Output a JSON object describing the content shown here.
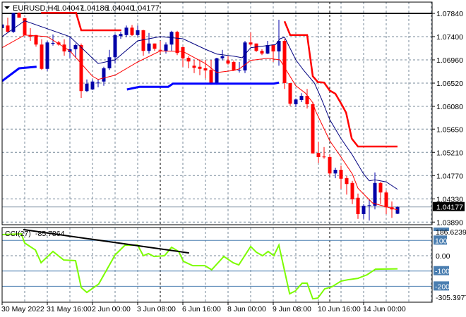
{
  "header": {
    "symbol": "EURUSD,H4",
    "open": "1.04047",
    "high": "1.04186",
    "low": "1.04040",
    "close": "1.04177"
  },
  "colors": {
    "bull": "#0000a8",
    "bear": "#ff0000",
    "ma_fast": "#000080",
    "ma_slow": "#ff0000",
    "stop_upper": "#ff0000",
    "stop_lower": "#0000ff",
    "cci": "#7cfc00",
    "level": "#4a7eb0",
    "grid": "#778899"
  },
  "chart_data": [
    {
      "type": "candlestick",
      "title": "EURUSD,H4",
      "ylim": [
        1.0389,
        1.0784
      ],
      "y_ticks": [
        "1.07840",
        "1.07400",
        "1.06960",
        "1.06520",
        "1.06080",
        "1.05650",
        "1.05210",
        "1.04770",
        "1.04330",
        "1.03890"
      ],
      "y_tick_values": [
        1.0784,
        1.074,
        1.0696,
        1.0652,
        1.0608,
        1.0565,
        1.0521,
        1.0477,
        1.0433,
        1.0389
      ],
      "current_price_label": "1.04177",
      "current_price": 1.04177,
      "horizontal_line": 1.0784,
      "x_tick_labels": [
        "30 May 2022",
        "31 May 16:00",
        "2 Jun 00:00",
        "3 Jun 08:00",
        "6 Jun 16:00",
        "8 Jun 00:00",
        "9 Jun 08:00",
        "10 Jun 16:00",
        "14 Jun 00:00"
      ],
      "x_tick_candle_index": [
        0,
        8,
        16,
        24,
        32,
        40,
        48,
        56,
        64
      ],
      "period_separators": [
        28,
        58
      ],
      "ohlc": [
        [
          1.0756,
          1.0767,
          1.0743,
          1.0763
        ],
        [
          1.0761,
          1.0776,
          1.0749,
          1.0749
        ],
        [
          1.0749,
          1.0785,
          1.0747,
          1.0785
        ],
        [
          1.0785,
          1.0786,
          1.0776,
          1.0776
        ],
        [
          1.0775,
          1.0775,
          1.0743,
          1.0743
        ],
        [
          1.0743,
          1.0756,
          1.0732,
          1.074
        ],
        [
          1.0743,
          1.0743,
          1.0721,
          1.0725
        ],
        [
          1.0725,
          1.0735,
          1.0677,
          1.0679
        ],
        [
          1.0679,
          1.0732,
          1.0675,
          1.0729
        ],
        [
          1.0727,
          1.0744,
          1.0723,
          1.0728
        ],
        [
          1.0729,
          1.0732,
          1.0723,
          1.0725
        ],
        [
          1.0725,
          1.0735,
          1.0704,
          1.0712
        ],
        [
          1.0711,
          1.074,
          1.07,
          1.0716
        ],
        [
          1.0716,
          1.0727,
          1.07,
          1.0724
        ],
        [
          1.0724,
          1.0727,
          1.0624,
          1.0637
        ],
        [
          1.0637,
          1.0659,
          1.0635,
          1.0651
        ],
        [
          1.064,
          1.0659,
          1.0639,
          1.0655
        ],
        [
          1.0652,
          1.0659,
          1.0644,
          1.0653
        ],
        [
          1.0655,
          1.0683,
          1.0647,
          1.068
        ],
        [
          1.068,
          1.0715,
          1.0677,
          1.0701
        ],
        [
          1.0701,
          1.0745,
          1.0689,
          1.0743
        ],
        [
          1.0741,
          1.0749,
          1.0736,
          1.0745
        ],
        [
          1.0743,
          1.0761,
          1.0739,
          1.0757
        ],
        [
          1.0757,
          1.0762,
          1.0741,
          1.0743
        ],
        [
          1.0743,
          1.0761,
          1.074,
          1.0752
        ],
        [
          1.0752,
          1.0753,
          1.0704,
          1.0713
        ],
        [
          1.0713,
          1.0747,
          1.0708,
          1.0727
        ],
        [
          1.0727,
          1.0727,
          1.0713,
          1.0717
        ],
        [
          1.0715,
          1.0732,
          1.0708,
          1.0714
        ],
        [
          1.0713,
          1.0729,
          1.0708,
          1.0725
        ],
        [
          1.0725,
          1.0751,
          1.0713,
          1.0749
        ],
        [
          1.0749,
          1.0751,
          1.0705,
          1.0709
        ],
        [
          1.072,
          1.0721,
          1.0683,
          1.0699
        ],
        [
          1.07,
          1.0703,
          1.068,
          1.0693
        ],
        [
          1.0685,
          1.0696,
          1.0671,
          1.0681
        ],
        [
          1.0683,
          1.0697,
          1.0667,
          1.0679
        ],
        [
          1.068,
          1.0696,
          1.0661,
          1.0676
        ],
        [
          1.0677,
          1.0696,
          1.0649,
          1.0652
        ],
        [
          1.0652,
          1.07,
          1.0649,
          1.0699
        ],
        [
          1.0699,
          1.0715,
          1.0695,
          1.0703
        ],
        [
          1.0695,
          1.0703,
          1.0687,
          1.0689
        ],
        [
          1.0692,
          1.0695,
          1.0675,
          1.0676
        ],
        [
          1.0676,
          1.0692,
          1.0672,
          1.0677
        ],
        [
          1.0676,
          1.0732,
          1.0671,
          1.0729
        ],
        [
          1.0729,
          1.0748,
          1.0721,
          1.0725
        ],
        [
          1.0727,
          1.0727,
          1.0711,
          1.0713
        ],
        [
          1.0713,
          1.0716,
          1.0705,
          1.0708
        ],
        [
          1.0708,
          1.0732,
          1.0707,
          1.0724
        ],
        [
          1.0725,
          1.0725,
          1.0692,
          1.0712
        ],
        [
          1.0712,
          1.0772,
          1.0685,
          1.0732
        ],
        [
          1.0732,
          1.0736,
          1.0641,
          1.0652
        ],
        [
          1.0652,
          1.0652,
          1.0609,
          1.0613
        ],
        [
          1.0612,
          1.0623,
          1.0607,
          1.0621
        ],
        [
          1.062,
          1.0633,
          1.0616,
          1.0628
        ],
        [
          1.0628,
          1.0641,
          1.0604,
          1.0612
        ],
        [
          1.0612,
          1.0616,
          1.0519,
          1.0519
        ],
        [
          1.052,
          1.0541,
          1.0501,
          1.0512
        ],
        [
          1.0513,
          1.0531,
          1.0509,
          1.0512
        ],
        [
          1.0512,
          1.0517,
          1.0477,
          1.0481
        ],
        [
          1.0481,
          1.0492,
          1.0472,
          1.0488
        ],
        [
          1.0488,
          1.0496,
          1.0452,
          1.0471
        ],
        [
          1.0472,
          1.0476,
          1.0441,
          1.0461
        ],
        [
          1.0463,
          1.0467,
          1.0423,
          1.0432
        ],
        [
          1.0435,
          1.0443,
          1.0395,
          1.0404
        ],
        [
          1.0404,
          1.0423,
          1.0395,
          1.042
        ],
        [
          1.042,
          1.0433,
          1.0392,
          1.0421
        ],
        [
          1.042,
          1.0483,
          1.0413,
          1.0463
        ],
        [
          1.0463,
          1.0465,
          1.0423,
          1.0445
        ],
        [
          1.0445,
          1.0449,
          1.0404,
          1.0417
        ],
        [
          1.0417,
          1.0428,
          1.0397,
          1.0413
        ],
        [
          1.04047,
          1.04186,
          1.0404,
          1.04177
        ]
      ],
      "overlays": [
        {
          "name": "ma-fast",
          "points": [
            [
              0,
              1.074
            ],
            [
              4,
              1.077
            ],
            [
              12,
              1.074
            ],
            [
              17,
              1.0689
            ],
            [
              20,
              1.0696
            ],
            [
              24,
              1.0732
            ],
            [
              28,
              1.074
            ],
            [
              32,
              1.0736
            ],
            [
              36,
              1.0716
            ],
            [
              38,
              1.0707
            ],
            [
              41,
              1.0703
            ],
            [
              42.5,
              1.07
            ],
            [
              44,
              1.0719
            ],
            [
              48.4,
              1.0725
            ],
            [
              49.2,
              1.0736
            ],
            [
              50,
              1.0739
            ],
            [
              52,
              1.0696
            ],
            [
              53.4,
              1.0676
            ],
            [
              55.3,
              1.0652
            ],
            [
              56.5,
              1.0623
            ],
            [
              57.4,
              1.0599
            ],
            [
              58,
              1.0583
            ],
            [
              60,
              1.0547
            ],
            [
              62,
              1.0516
            ],
            [
              64,
              1.048
            ],
            [
              65,
              1.0467
            ],
            [
              66,
              1.0469
            ],
            [
              68,
              1.0465
            ],
            [
              70,
              1.0451
            ]
          ]
        },
        {
          "name": "ma-slow",
          "points": [
            [
              0,
              1.0719
            ],
            [
              4,
              1.0743
            ],
            [
              8,
              1.074
            ],
            [
              12,
              1.0713
            ],
            [
              16,
              1.0665
            ],
            [
              17,
              1.0659
            ],
            [
              20,
              1.0667
            ],
            [
              24,
              1.0692
            ],
            [
              28,
              1.0713
            ],
            [
              32,
              1.0712
            ],
            [
              36,
              1.0689
            ],
            [
              38,
              1.0672
            ],
            [
              41,
              1.0676
            ],
            [
              42,
              1.0679
            ],
            [
              44,
              1.0695
            ],
            [
              47,
              1.0699
            ],
            [
              49.2,
              1.0696
            ],
            [
              50.5,
              1.0673
            ],
            [
              52,
              1.0647
            ],
            [
              53.7,
              1.0633
            ],
            [
              55,
              1.0615
            ],
            [
              55.5,
              1.0599
            ],
            [
              58,
              1.0543
            ],
            [
              60,
              1.0512
            ],
            [
              62,
              1.048
            ],
            [
              63,
              1.0453
            ],
            [
              64,
              1.0442
            ],
            [
              65.6,
              1.0425
            ],
            [
              68,
              1.0418
            ],
            [
              70,
              1.0412
            ]
          ]
        },
        {
          "name": "stop-upper-1",
          "points": [
            [
              6.9,
              1.0785
            ],
            [
              13.1,
              1.0785
            ],
            [
              14,
              1.0752
            ],
            [
              21.1,
              1.0752
            ]
          ]
        },
        {
          "name": "stop-upper-2",
          "points": [
            [
              50,
              1.0769
            ],
            [
              51,
              1.0743
            ],
            [
              54,
              1.0743
            ],
            [
              55,
              1.0665
            ],
            [
              55.9,
              1.0654
            ],
            [
              57,
              1.0653
            ],
            [
              58,
              1.0638
            ],
            [
              59,
              1.0632
            ],
            [
              60.25,
              1.0609
            ],
            [
              60.9,
              1.0596
            ],
            [
              61.9,
              1.0547
            ],
            [
              63,
              1.0532
            ],
            [
              70,
              1.0532
            ]
          ]
        },
        {
          "name": "stop-lower-1",
          "points": [
            [
              0,
              1.0656
            ],
            [
              3,
              1.068
            ],
            [
              6.1,
              1.0683
            ]
          ]
        },
        {
          "name": "stop-lower-2",
          "points": [
            [
              22.1,
              1.064
            ],
            [
              24.3,
              1.0645
            ],
            [
              29.4,
              1.0645
            ],
            [
              30.25,
              1.0651
            ],
            [
              48.1,
              1.0651
            ],
            [
              49,
              1.0653
            ]
          ]
        }
      ]
    },
    {
      "type": "line",
      "title": "CCI(27)",
      "current_value_label": "-85.7864",
      "ylim": [
        -305.3977,
        186.6239
      ],
      "max_label": "186.6239",
      "min_label": "-305.3977",
      "level_labels": [
        "100",
        "0.00",
        "-100",
        "-200"
      ],
      "levels": [
        100,
        0,
        -100,
        -200
      ],
      "series": [
        [
          0,
          138
        ],
        [
          3.4,
          143
        ],
        [
          4,
          83
        ],
        [
          5.9,
          37
        ],
        [
          6.9,
          -46
        ],
        [
          9,
          28
        ],
        [
          10.9,
          -28
        ],
        [
          13,
          -32
        ],
        [
          14,
          -208
        ],
        [
          15,
          -240
        ],
        [
          17.1,
          -185
        ],
        [
          20,
          5
        ],
        [
          21.75,
          69
        ],
        [
          24,
          69
        ],
        [
          25,
          0
        ],
        [
          25.9,
          14
        ],
        [
          26.9,
          -5
        ],
        [
          28.75,
          0
        ],
        [
          30,
          55
        ],
        [
          31.25,
          28
        ],
        [
          32.1,
          -37
        ],
        [
          33.75,
          -65
        ],
        [
          35.9,
          -65
        ],
        [
          37.1,
          -92
        ],
        [
          39.25,
          -5
        ],
        [
          40.9,
          -46
        ],
        [
          41.9,
          -60
        ],
        [
          44,
          60
        ],
        [
          45,
          23
        ],
        [
          46.1,
          0
        ],
        [
          47.1,
          28
        ],
        [
          48.1,
          0
        ],
        [
          49,
          69
        ],
        [
          50.9,
          -249
        ],
        [
          51.9,
          -231
        ],
        [
          53.1,
          -180
        ],
        [
          54,
          -180
        ],
        [
          55,
          -282
        ],
        [
          55.9,
          -277
        ],
        [
          57.1,
          -217
        ],
        [
          58.4,
          -203
        ],
        [
          60,
          -166
        ],
        [
          61.25,
          -157
        ],
        [
          63,
          -148
        ],
        [
          64.6,
          -125
        ],
        [
          66.1,
          -88
        ],
        [
          70,
          -85.79
        ]
      ],
      "trendline": [
        [
          3.75,
          171
        ],
        [
          33.1,
          18
        ]
      ]
    }
  ]
}
